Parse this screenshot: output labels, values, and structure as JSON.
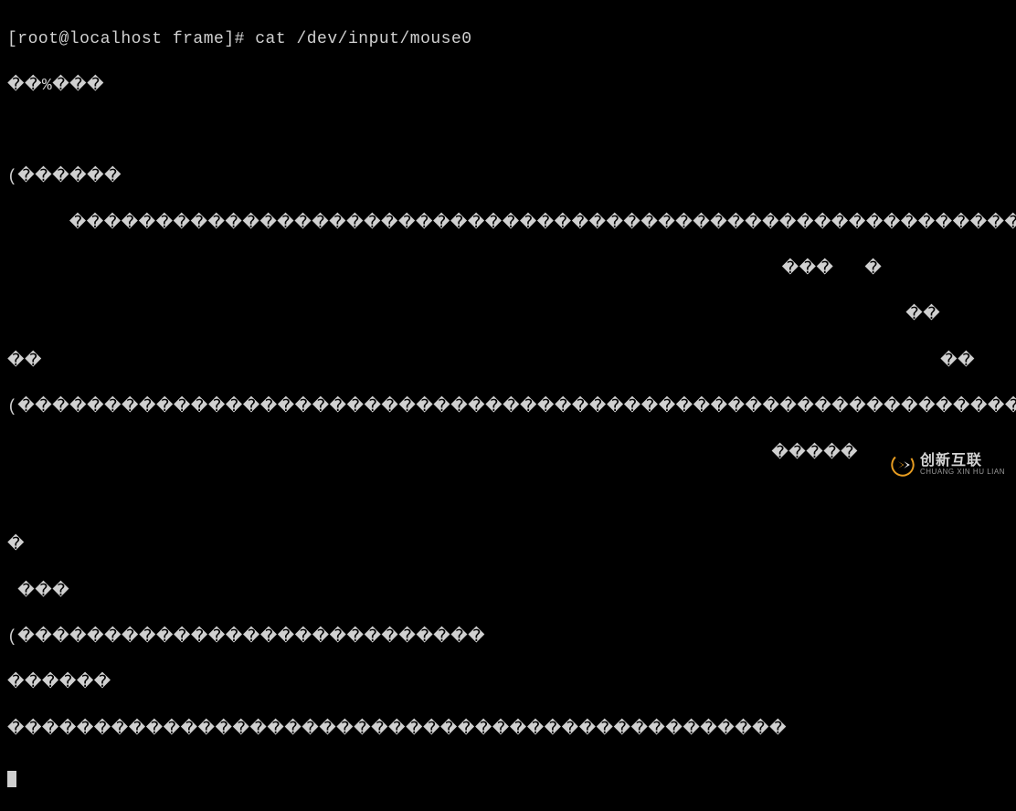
{
  "terminal": {
    "prompt": "[root@localhost frame]# ",
    "command": "cat /dev/input/mouse0",
    "output_lines": [
      "��%���",
      "",
      "(������",
      "      ����������������������������������������������������������������������",
      "                                                                           ���   �",
      "                                                                                       ��",
      "��                                                                                       ��",
      "(�������������������������������������������������������������������������",
      "                                                                          �����",
      "",
      "�",
      " ���",
      "(���������������������������",
      "������",
      "���������������������������������������������"
    ]
  },
  "watermark": {
    "cn": "创新互联",
    "en": "CHUANG XIN HU LIAN"
  }
}
